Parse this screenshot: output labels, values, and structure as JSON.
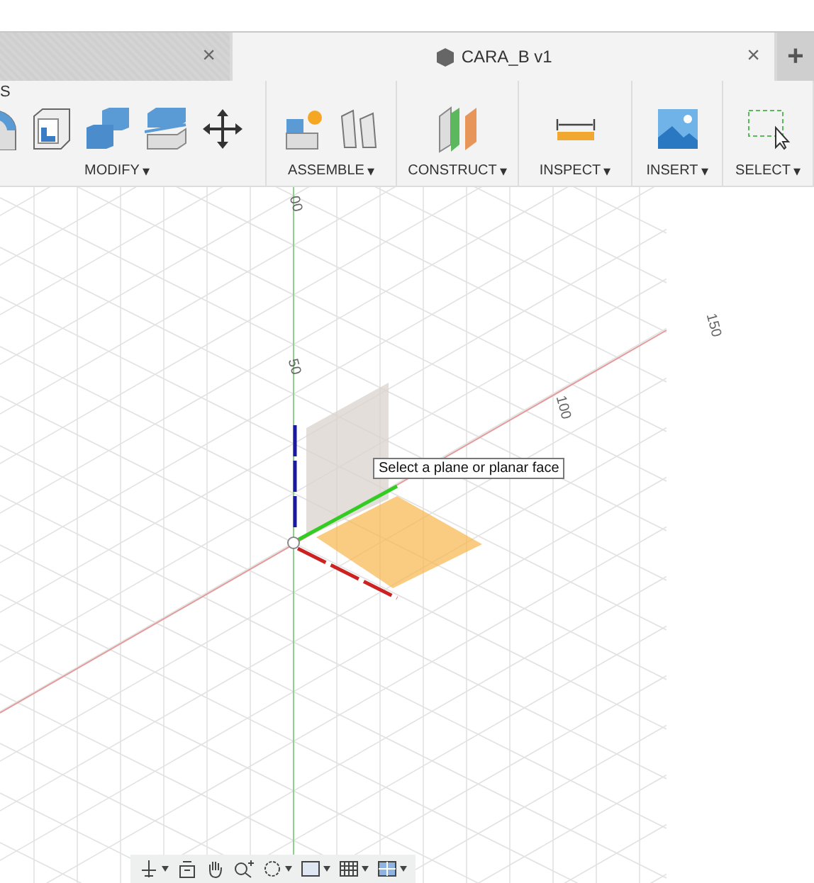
{
  "tabs": [
    {
      "selected": false,
      "close": "×"
    },
    {
      "selected": true,
      "title": "CARA_B v1",
      "close": "×"
    }
  ],
  "new_tab": "+",
  "toolbar": {
    "cut_label": "S",
    "groups": [
      {
        "label": "MODIFY",
        "caret": "▾",
        "icons": [
          {
            "kind": "fillet"
          },
          {
            "kind": "shell"
          },
          {
            "kind": "combine"
          },
          {
            "kind": "split"
          },
          {
            "kind": "move"
          }
        ]
      },
      {
        "label": "ASSEMBLE",
        "caret": "▾",
        "icons": [
          {
            "kind": "component"
          },
          {
            "kind": "joint"
          }
        ]
      },
      {
        "label": "CONSTRUCT",
        "caret": "▾",
        "icons": [
          {
            "kind": "planes"
          }
        ]
      },
      {
        "label": "INSPECT",
        "caret": "▾",
        "icons": [
          {
            "kind": "measure"
          }
        ]
      },
      {
        "label": "INSERT",
        "caret": "▾",
        "icons": [
          {
            "kind": "image"
          }
        ]
      },
      {
        "label": "SELECT",
        "caret": "▾",
        "icons": [
          {
            "kind": "select"
          }
        ]
      }
    ]
  },
  "viewport": {
    "axis_labels": [
      "00",
      "50",
      "100",
      "150"
    ],
    "tooltip": "Select a plane or planar face",
    "nav_tools": [
      {
        "kind": "orbit",
        "menu": true
      },
      {
        "kind": "look",
        "menu": false
      },
      {
        "kind": "pan",
        "menu": false
      },
      {
        "kind": "zoom",
        "menu": false
      },
      {
        "kind": "fit",
        "menu": true
      },
      {
        "kind": "display",
        "menu": true
      },
      {
        "kind": "grid",
        "menu": true
      },
      {
        "kind": "viewports",
        "menu": true
      }
    ]
  }
}
